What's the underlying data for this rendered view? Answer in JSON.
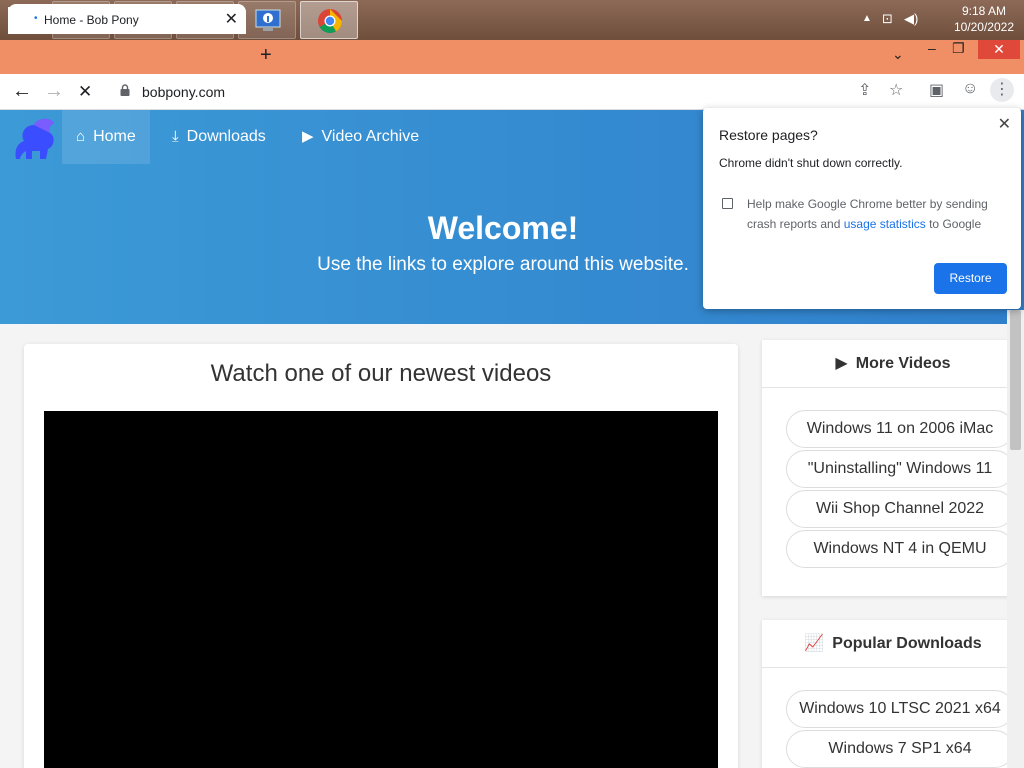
{
  "taskbar": {
    "apps": [
      {
        "name": "file-explorer-icon",
        "active": false
      },
      {
        "name": "task-manager-icon",
        "active": false
      },
      {
        "name": "scanner-icon",
        "active": false
      },
      {
        "name": "system-info-icon",
        "active": false
      },
      {
        "name": "chrome-icon",
        "active": true
      }
    ],
    "clock": {
      "time": "9:18 AM",
      "date": "10/20/2022"
    }
  },
  "browser": {
    "tab": {
      "title": "Home - Bob Pony"
    },
    "url": "bobpony.com",
    "accent": "#f08f66"
  },
  "site": {
    "nav": [
      {
        "label": "Home",
        "icon": "home-icon"
      },
      {
        "label": "Downloads",
        "icon": "download-icon"
      },
      {
        "label": "Video Archive",
        "icon": "video-icon"
      }
    ],
    "hero": {
      "title": "Welcome!",
      "subtitle": "Use the links to explore around this website."
    },
    "video_section": {
      "heading": "Watch one of our newest videos"
    },
    "more_videos": {
      "heading": "More Videos",
      "items": [
        "Windows 11 on 2006 iMac",
        "\"Uninstalling\" Windows 11",
        "Wii Shop Channel 2022",
        "Windows NT 4 in QEMU"
      ]
    },
    "popular_downloads": {
      "heading": "Popular Downloads",
      "items": [
        "Windows 10 LTSC 2021 x64",
        "Windows 7 SP1 x64"
      ]
    }
  },
  "restore_bubble": {
    "title": "Restore pages?",
    "message": "Chrome didn't shut down correctly.",
    "checkbox_prefix": "Help make Google Chrome better by sending crash reports and ",
    "checkbox_link": "usage statistics",
    "checkbox_suffix": " to Google",
    "button": "Restore"
  }
}
